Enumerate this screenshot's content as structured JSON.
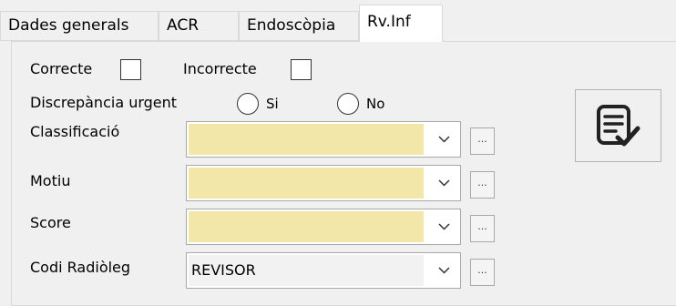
{
  "tabs": [
    {
      "label": "Dades generals",
      "active": false
    },
    {
      "label": "ACR",
      "active": false
    },
    {
      "label": "Endoscòpia",
      "active": false
    },
    {
      "label": "Rv.Inf",
      "active": true
    }
  ],
  "review": {
    "correcte_label": "Correcte",
    "correcte_checked": false,
    "incorrecte_label": "Incorrecte",
    "incorrecte_checked": false,
    "discrepancia_label": "Discrepància urgent",
    "option_si_label": "Si",
    "option_no_label": "No",
    "selected_option": null
  },
  "fields": {
    "classificacio": {
      "label": "Classificació",
      "value": "",
      "button_label": "..."
    },
    "motiu": {
      "label": "Motiu",
      "value": "",
      "button_label": "..."
    },
    "score": {
      "label": "Score",
      "value": "",
      "button_label": "..."
    },
    "codi_radioleg": {
      "label": "Codi Radiòleg",
      "value": "REVISOR",
      "button_label": "..."
    }
  },
  "colors": {
    "required_field_bg": "#f2e6a8",
    "panel_bg": "#f0f0f0",
    "active_tab_bg": "#ffffff"
  },
  "icons": {
    "submit_button": "clipboard-check-icon",
    "combo_arrow": "chevron-down-icon"
  }
}
